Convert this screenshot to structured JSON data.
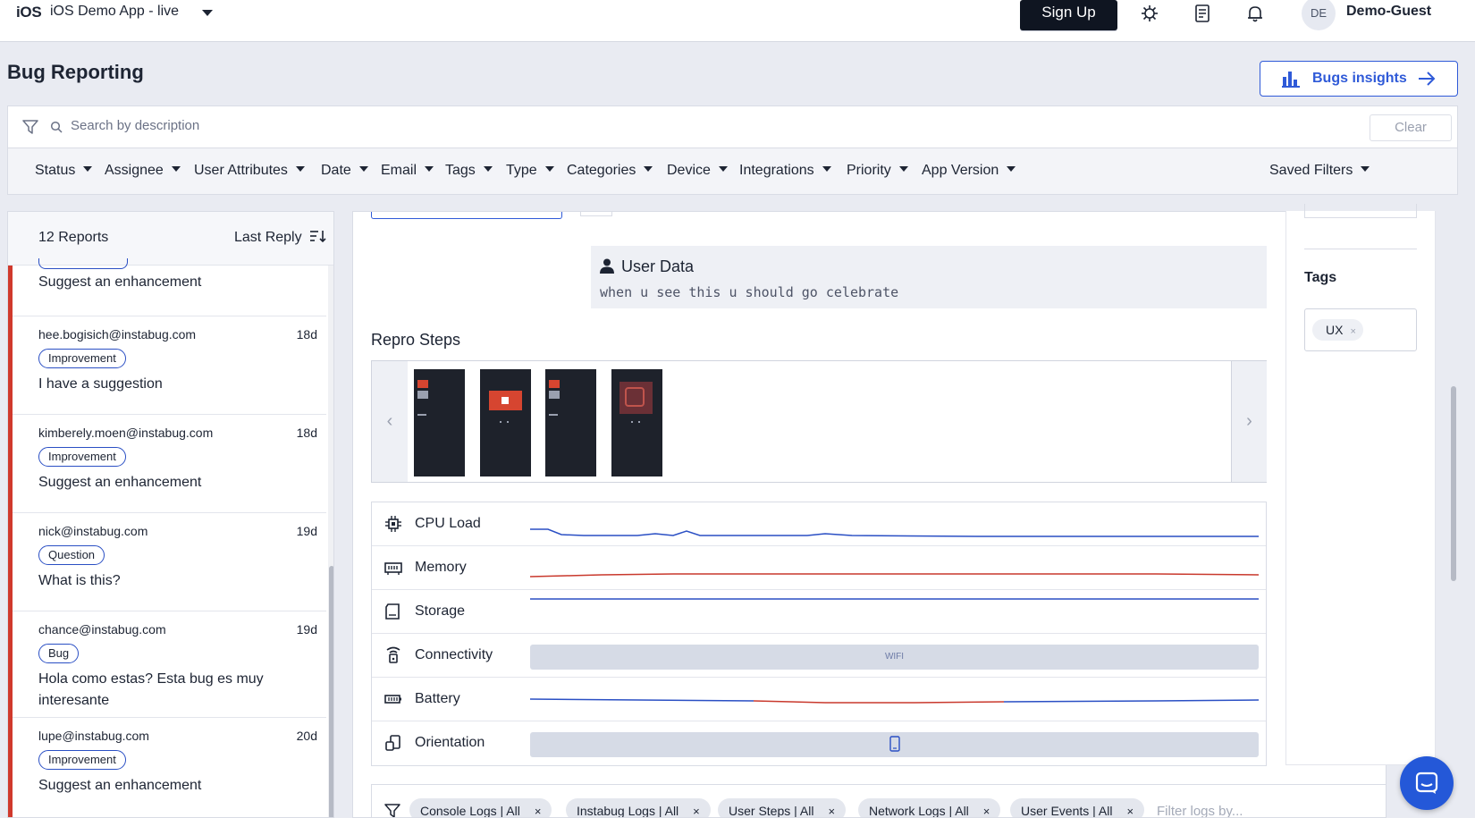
{
  "topbar": {
    "brand": "iOS",
    "app_name": "iOS Demo App - live",
    "signup_label": "Sign Up",
    "avatar_initials": "DE",
    "user_name": "Demo-Guest"
  },
  "page": {
    "title": "Bug Reporting",
    "insights_label": "Bugs insights"
  },
  "search": {
    "placeholder": "Search by description",
    "clear_label": "Clear"
  },
  "filters": [
    "Status",
    "Assignee",
    "User Attributes",
    "Date",
    "Email",
    "Tags",
    "Type",
    "Categories",
    "Device",
    "Integrations",
    "Priority",
    "App Version"
  ],
  "saved_filters_label": "Saved Filters",
  "reports": {
    "count_label": "12 Reports",
    "sort_label": "Last Reply",
    "items": [
      {
        "email": "",
        "age": "",
        "badge": "",
        "description": "Suggest an enhancement"
      },
      {
        "email": "hee.bogisich@instabug.com",
        "age": "18d",
        "badge": "Improvement",
        "description": "I have a suggestion"
      },
      {
        "email": "kimberely.moen@instabug.com",
        "age": "18d",
        "badge": "Improvement",
        "description": "Suggest an enhancement"
      },
      {
        "email": "nick@instabug.com",
        "age": "19d",
        "badge": "Question",
        "description": "What is this?"
      },
      {
        "email": "chance@instabug.com",
        "age": "19d",
        "badge": "Bug",
        "description": "Hola como estas? Esta bug es muy interesante"
      },
      {
        "email": "lupe@instabug.com",
        "age": "20d",
        "badge": "Improvement",
        "description": "Suggest an enhancement"
      }
    ]
  },
  "user_data": {
    "title": "User Data",
    "text": "when u see this u should go celebrate"
  },
  "repro": {
    "title": "Repro Steps",
    "screenshot_count": 4
  },
  "metrics": {
    "cpu": "CPU Load",
    "memory": "Memory",
    "storage": "Storage",
    "connectivity": "Connectivity",
    "connectivity_value": "WIFI",
    "battery": "Battery",
    "orientation": "Orientation",
    "colors": {
      "blue": "#2a4fc4",
      "red": "#c9392d"
    }
  },
  "logs": {
    "chips": [
      "Console Logs | All",
      "Instabug Logs | All",
      "User Steps | All",
      "Network Logs | All",
      "User Events | All"
    ],
    "filter_placeholder": "Filter logs by..."
  },
  "tags": {
    "title": "Tags",
    "items": [
      "UX"
    ]
  },
  "icons": [
    "ios-logo",
    "caret-down-icon",
    "bug-icon",
    "notes-icon",
    "bell-icon",
    "bar-chart-icon",
    "arrow-right-icon",
    "filter-icon",
    "search-icon",
    "sort-icon",
    "user-icon",
    "cpu-icon",
    "memory-icon",
    "storage-icon",
    "wifi-icon",
    "battery-icon",
    "orientation-icon",
    "chat-icon"
  ]
}
